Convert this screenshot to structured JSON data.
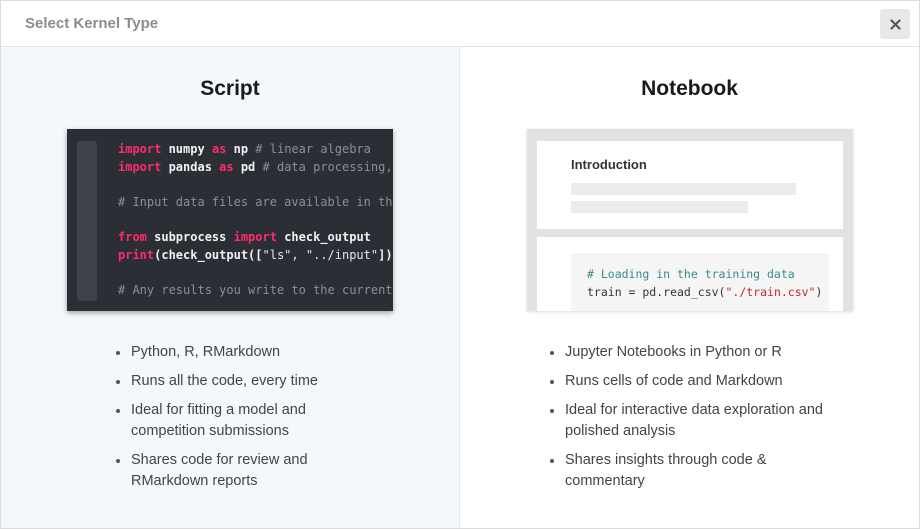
{
  "dialog": {
    "title": "Select Kernel Type",
    "close_icon": "close-icon"
  },
  "script": {
    "title": "Script",
    "code_lines": [
      [
        {
          "t": "kw",
          "v": "import"
        },
        {
          "t": "nm",
          "v": " numpy "
        },
        {
          "t": "kw",
          "v": "as"
        },
        {
          "t": "nm",
          "v": " np "
        },
        {
          "t": "cm",
          "v": "# linear algebra"
        }
      ],
      [
        {
          "t": "kw",
          "v": "import"
        },
        {
          "t": "nm",
          "v": " pandas "
        },
        {
          "t": "kw",
          "v": "as"
        },
        {
          "t": "nm",
          "v": " pd "
        },
        {
          "t": "cm",
          "v": "# data processing,"
        }
      ],
      [],
      [
        {
          "t": "cm",
          "v": "# Input data files are available in th"
        }
      ],
      [],
      [
        {
          "t": "kw",
          "v": "from"
        },
        {
          "t": "nm",
          "v": " subprocess "
        },
        {
          "t": "kw",
          "v": "import"
        },
        {
          "t": "nm",
          "v": " check_output"
        }
      ],
      [
        {
          "t": "kw",
          "v": "print"
        },
        {
          "t": "nm",
          "v": "(check_output(["
        },
        {
          "t": "st",
          "v": "\"ls\", \"../input\""
        },
        {
          "t": "nm",
          "v": "])"
        }
      ],
      [],
      [
        {
          "t": "cm",
          "v": "# Any results you write to the current"
        }
      ]
    ],
    "features": [
      "Python, R, RMarkdown",
      "Runs all the code, every time",
      "Ideal for fitting a model and competition submissions",
      "Shares code for review and RMarkdown reports"
    ]
  },
  "notebook": {
    "title": "Notebook",
    "preview_heading": "Introduction",
    "code_comment": "# Loading in the training data",
    "code_prefix": "train = pd.read_csv(",
    "code_string": "\"./train.csv\"",
    "code_suffix": ")",
    "features": [
      "Jupyter Notebooks in Python or R",
      "Runs cells of code and Markdown",
      "Ideal for interactive data exploration and polished analysis",
      "Shares insights through code & commentary"
    ]
  },
  "colors": {
    "keyword": "#ff2a6d",
    "comment": "#8c8f96",
    "script_bg": "#f3f8fb",
    "code_bg": "#2b2e35"
  }
}
